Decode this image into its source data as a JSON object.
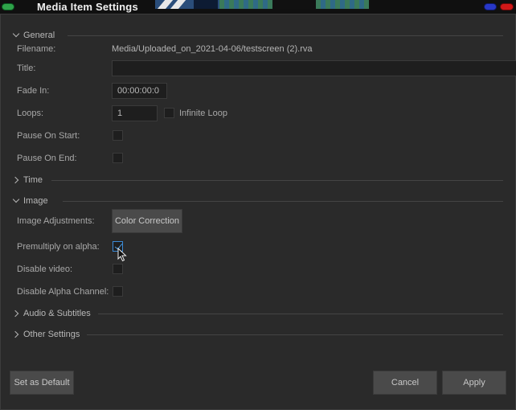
{
  "window": {
    "title": "Media Item Settings"
  },
  "sections": {
    "general": "General",
    "time": "Time",
    "image": "Image",
    "audio_subtitles": "Audio & Subtitles",
    "other_settings": "Other Settings"
  },
  "general": {
    "filename_label": "Filename:",
    "filename_value": "Media/Uploaded_on_2021-04-06/testscreen (2).rva",
    "title_label": "Title:",
    "title_value": "",
    "fade_in_label": "Fade In:",
    "fade_in_value": "00:00:00:0",
    "loops_label": "Loops:",
    "loops_value": "1",
    "infinite_loop_label": "Infinite Loop",
    "infinite_loop_checked": false,
    "pause_on_start_label": "Pause On Start:",
    "pause_on_start_checked": false,
    "pause_on_end_label": "Pause On End:",
    "pause_on_end_checked": false
  },
  "image": {
    "adjustments_label": "Image Adjustments:",
    "color_correction_button": "Color Correction",
    "premultiply_label": "Premultiply on alpha:",
    "premultiply_checked": true,
    "disable_video_label": "Disable video:",
    "disable_video_checked": false,
    "disable_alpha_label": "Disable Alpha Channel:",
    "disable_alpha_checked": false
  },
  "footer": {
    "set_default_button": "Set as Default",
    "cancel_button": "Cancel",
    "apply_button": "Apply"
  },
  "colors": {
    "background": "#2a2a2a",
    "field": "#1e1e1e",
    "button": "#4a4a4a",
    "accent": "#3b8ad6",
    "window_close": "#2fa34a",
    "window_minimize": "#2838c8",
    "window_maximize": "#d01818"
  }
}
